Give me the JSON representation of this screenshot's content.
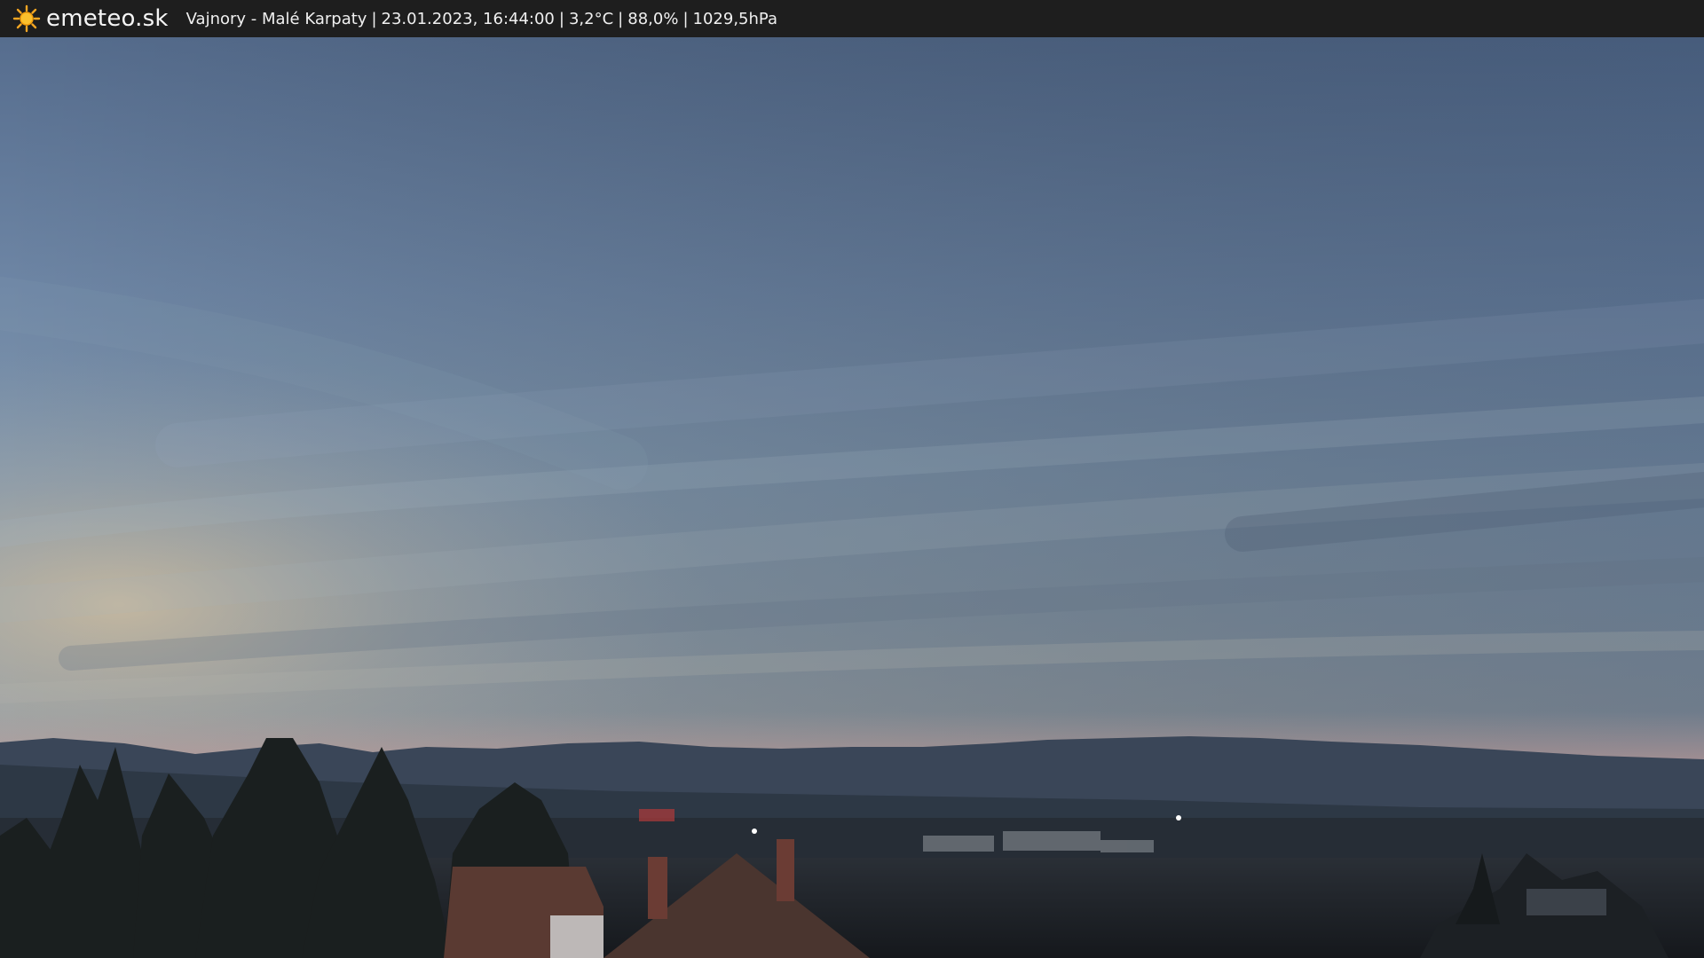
{
  "header": {
    "brand": "emeteo.sk",
    "logo_icon": "sun-icon",
    "location": "Vajnory - Malé Karpaty",
    "datetime": "23.01.2023, 16:44:00",
    "temperature": "3,2°C",
    "humidity": "88,0%",
    "pressure": "1029,5hPa",
    "separator": "|"
  },
  "scene": {
    "description_icon": "webcam-landscape-image",
    "colors": {
      "sky_top": "#566d8e",
      "sky_mid": "#7f93ad",
      "sky_low": "#8b9ba7",
      "horizon_glow": "#c9b7a0",
      "mountains": "#2f3b4b",
      "ground": "#1b1f24"
    }
  }
}
